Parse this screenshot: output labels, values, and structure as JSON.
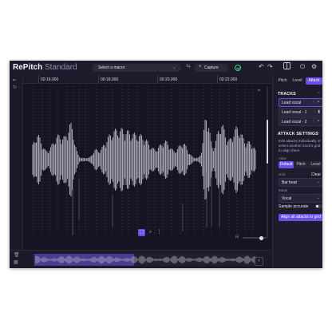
{
  "app": {
    "brand_bold": "RePitch",
    "brand_light": "Standard",
    "macro_placeholder": "Select a macro",
    "capture_label": "Capture",
    "icons": [
      "undo-icon",
      "redo-icon",
      "layout-icon",
      "power-icon",
      "gear-icon"
    ]
  },
  "timeline": {
    "ticks": [
      "00:16.000",
      "00:18.000",
      "00:20.000",
      "00:22.000"
    ],
    "lane_label": "lv.",
    "zoom_label": "⊟"
  },
  "panel": {
    "tabs": [
      "Pitch",
      "Level",
      "Attack"
    ],
    "active_tab": "Attack",
    "tracks_title": "TRACKS",
    "tracks": [
      "Lead vocal",
      "Lead vocal - 1",
      "Lead vocal - 2"
    ],
    "attack_title": "ATTACK SETTINGS",
    "attack_desc": "Edit attacks individually or select another track's grid to align them.",
    "view_label": "View",
    "view_options": [
      "Default",
      "Pitch",
      "Level"
    ],
    "view_active": "Default",
    "grid_label": "Grid",
    "clear_label": "Clear",
    "grid_value": "Bar beat",
    "mode_label": "Mode",
    "mode_value": "Vocal",
    "sample_label": "Sample accurate",
    "align_button": "Align all attacks to grid"
  },
  "colors": {
    "accent": "#6d4ee6",
    "background": "#1a1827",
    "waveform": "#a6a3b4",
    "ok": "#3fcf86"
  }
}
